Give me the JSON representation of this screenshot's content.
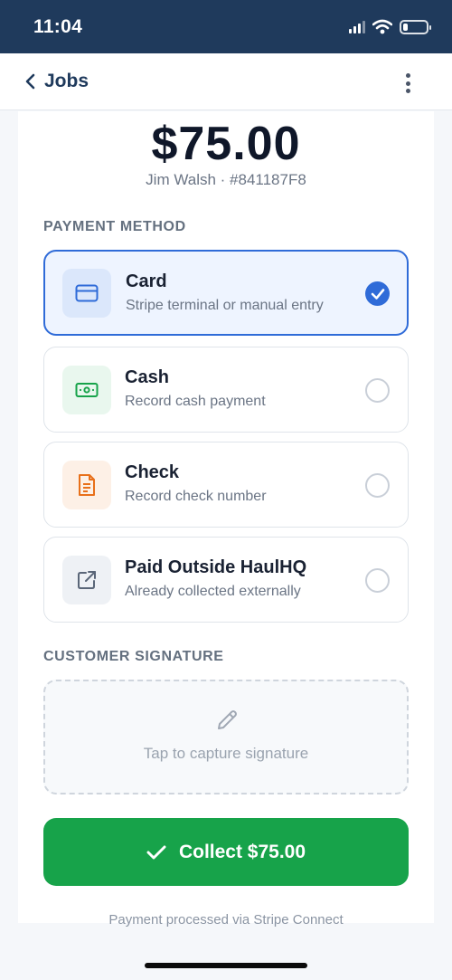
{
  "status_bar": {
    "time": "11:04",
    "battery_level": 0.2
  },
  "nav": {
    "back_label": "Jobs"
  },
  "payment": {
    "amount": "$75.00",
    "job_meta": "Jim Walsh · #841187F8"
  },
  "payment_method": {
    "section_label": "PAYMENT METHOD",
    "selected": "card",
    "options": [
      {
        "id": "card",
        "title": "Card",
        "subtitle": "Stripe terminal or manual entry",
        "icon": "credit-card-icon",
        "accent": "#2f6bd8",
        "icon_bg": "#dbe7fb"
      },
      {
        "id": "cash",
        "title": "Cash",
        "subtitle": "Record cash payment",
        "icon": "banknote-icon",
        "accent": "#17a34a",
        "icon_bg": "#e9f7ee"
      },
      {
        "id": "check",
        "title": "Check",
        "subtitle": "Record check number",
        "icon": "document-icon",
        "accent": "#e8701a",
        "icon_bg": "#fdf0e6"
      },
      {
        "id": "outside",
        "title": "Paid Outside HaulHQ",
        "subtitle": "Already collected externally",
        "icon": "external-link-icon",
        "accent": "#5a6678",
        "icon_bg": "#eef1f5"
      }
    ]
  },
  "signature": {
    "section_label": "CUSTOMER SIGNATURE",
    "placeholder": "Tap to capture signature",
    "icon": "pencil-icon"
  },
  "collect": {
    "label": "Collect $75.00",
    "icon": "check-icon",
    "color": "#17a34a"
  },
  "footer": {
    "note": "Payment processed via Stripe Connect"
  }
}
